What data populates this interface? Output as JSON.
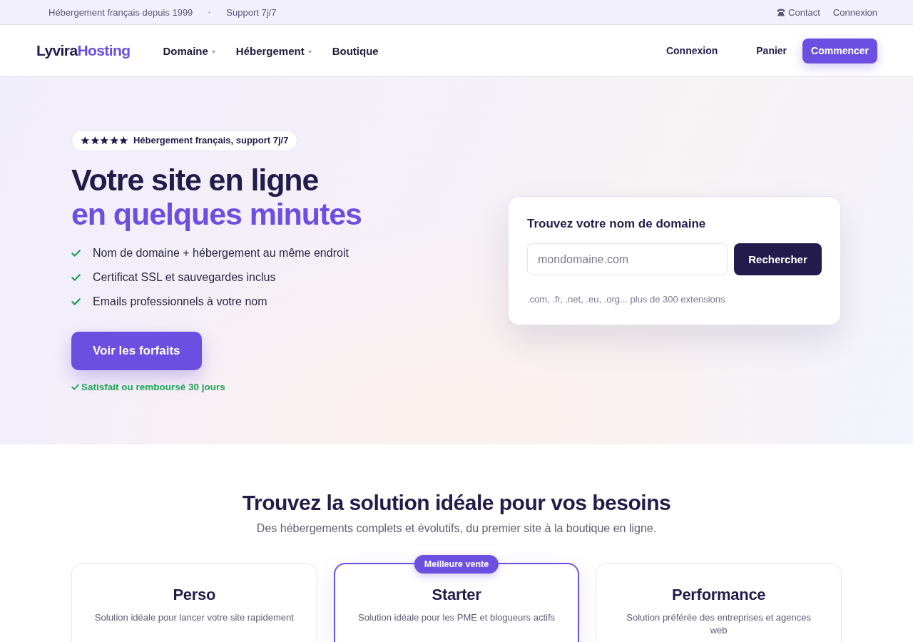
{
  "top_bar": {
    "info": [
      "Hébergement français depuis 1999",
      "Support 7j/7"
    ],
    "contact_link": "Contact",
    "login_link": "Connexion"
  },
  "header": {
    "logo": {
      "first": "Lyvira",
      "second": "Hosting"
    },
    "nav": [
      {
        "label": "Domaine",
        "has_dropdown": true
      },
      {
        "label": "Hébergement",
        "has_dropdown": true
      },
      {
        "label": "Boutique",
        "has_dropdown": false
      }
    ],
    "actions": [
      {
        "label": "Connexion",
        "kind": "link"
      },
      {
        "label": "Panier",
        "kind": "link"
      },
      {
        "label": "Commencer",
        "kind": "primary"
      }
    ]
  },
  "hero": {
    "badge": {
      "stars": 5,
      "text": "Hébergement français, support 7j/7"
    },
    "title": [
      {
        "text": "Votre site en ligne",
        "accent": false
      },
      {
        "text": "en quelques minutes",
        "accent": true
      }
    ],
    "features": [
      "Nom de domaine + hébergement au même endroit",
      "Certificat SSL et sauvegardes inclus",
      "Emails professionnels à votre nom"
    ],
    "cta": "Voir les forfaits",
    "guarantee": "Satisfait ou remboursé 30 jours"
  },
  "domain_search": {
    "title": "Trouvez votre nom de domaine",
    "placeholder": "mondomaine.com",
    "button": "Rechercher",
    "hint": ".com, .fr, .net, .eu, .org... plus de 300 extensions"
  },
  "plans": {
    "title": "Trouvez la solution idéale pour vos besoins",
    "subtitle": "Des hébergements complets et évolutifs, du premier site à la boutique en ligne.",
    "items": [
      {
        "name": "Perso",
        "description": "Solution idéale pour lancer votre site rapidement",
        "featured": false
      },
      {
        "name": "Starter",
        "description": "Solution idéale pour les PME et blogueurs actifs",
        "featured": true,
        "badge": "Meilleure vente"
      },
      {
        "name": "Performance",
        "description": "Solution préférée des entreprises et agences web",
        "featured": false
      }
    ]
  }
}
